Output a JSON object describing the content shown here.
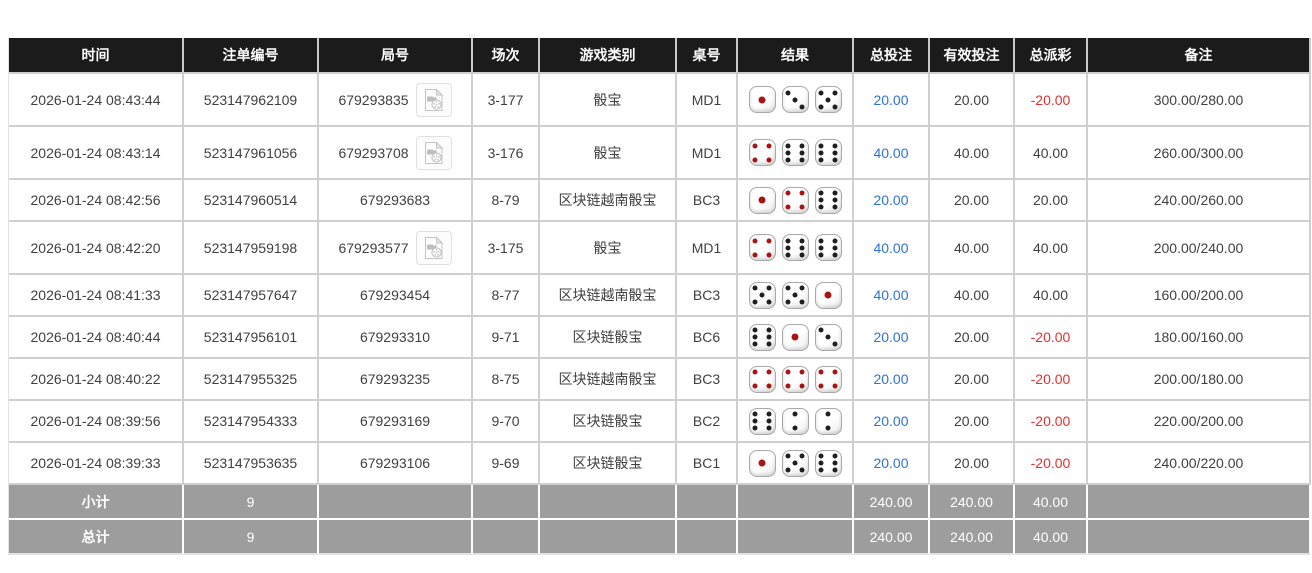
{
  "colors": {
    "header_bg": "#1b1b1b",
    "accent_blue": "#2e72d9",
    "negative_red": "#e03131",
    "summary_bg": "#9d9d9d",
    "grid_line": "#cfcfcf"
  },
  "icons": {
    "video_replay": "video-file-icon"
  },
  "table": {
    "columns": [
      {
        "key": "time",
        "label": "时间"
      },
      {
        "key": "bet_id",
        "label": "注单编号"
      },
      {
        "key": "round",
        "label": "局号"
      },
      {
        "key": "session",
        "label": "场次"
      },
      {
        "key": "game",
        "label": "游戏类别"
      },
      {
        "key": "table_no",
        "label": "桌号"
      },
      {
        "key": "result",
        "label": "结果"
      },
      {
        "key": "total_bet",
        "label": "总投注"
      },
      {
        "key": "valid_bet",
        "label": "有效投注"
      },
      {
        "key": "payout",
        "label": "总派彩"
      },
      {
        "key": "remark",
        "label": "备注"
      }
    ],
    "rows": [
      {
        "time": "2026-01-24 08:43:44",
        "bet_id": "523147962109",
        "round": "679293835",
        "has_video": true,
        "session": "3-177",
        "game": "骰宝",
        "table_no": "MD1",
        "dice": [
          1,
          3,
          5
        ],
        "total_bet": "20.00",
        "valid_bet": "20.00",
        "payout": "-20.00",
        "remark": "300.00/280.00"
      },
      {
        "time": "2026-01-24 08:43:14",
        "bet_id": "523147961056",
        "round": "679293708",
        "has_video": true,
        "session": "3-176",
        "game": "骰宝",
        "table_no": "MD1",
        "dice": [
          4,
          6,
          6
        ],
        "total_bet": "40.00",
        "valid_bet": "40.00",
        "payout": "40.00",
        "remark": "260.00/300.00"
      },
      {
        "time": "2026-01-24 08:42:56",
        "bet_id": "523147960514",
        "round": "679293683",
        "has_video": false,
        "session": "8-79",
        "game": "区块链越南骰宝",
        "table_no": "BC3",
        "dice": [
          1,
          4,
          6
        ],
        "total_bet": "20.00",
        "valid_bet": "20.00",
        "payout": "20.00",
        "remark": "240.00/260.00"
      },
      {
        "time": "2026-01-24 08:42:20",
        "bet_id": "523147959198",
        "round": "679293577",
        "has_video": true,
        "session": "3-175",
        "game": "骰宝",
        "table_no": "MD1",
        "dice": [
          4,
          6,
          6
        ],
        "total_bet": "40.00",
        "valid_bet": "40.00",
        "payout": "40.00",
        "remark": "200.00/240.00"
      },
      {
        "time": "2026-01-24 08:41:33",
        "bet_id": "523147957647",
        "round": "679293454",
        "has_video": false,
        "session": "8-77",
        "game": "区块链越南骰宝",
        "table_no": "BC3",
        "dice": [
          5,
          5,
          1
        ],
        "total_bet": "40.00",
        "valid_bet": "40.00",
        "payout": "40.00",
        "remark": "160.00/200.00"
      },
      {
        "time": "2026-01-24 08:40:44",
        "bet_id": "523147956101",
        "round": "679293310",
        "has_video": false,
        "session": "9-71",
        "game": "区块链骰宝",
        "table_no": "BC6",
        "dice": [
          6,
          1,
          3
        ],
        "total_bet": "20.00",
        "valid_bet": "20.00",
        "payout": "-20.00",
        "remark": "180.00/160.00"
      },
      {
        "time": "2026-01-24 08:40:22",
        "bet_id": "523147955325",
        "round": "679293235",
        "has_video": false,
        "session": "8-75",
        "game": "区块链越南骰宝",
        "table_no": "BC3",
        "dice": [
          4,
          4,
          4
        ],
        "total_bet": "20.00",
        "valid_bet": "20.00",
        "payout": "-20.00",
        "remark": "200.00/180.00"
      },
      {
        "time": "2026-01-24 08:39:56",
        "bet_id": "523147954333",
        "round": "679293169",
        "has_video": false,
        "session": "9-70",
        "game": "区块链骰宝",
        "table_no": "BC2",
        "dice": [
          6,
          2,
          2
        ],
        "total_bet": "20.00",
        "valid_bet": "20.00",
        "payout": "-20.00",
        "remark": "220.00/200.00"
      },
      {
        "time": "2026-01-24 08:39:33",
        "bet_id": "523147953635",
        "round": "679293106",
        "has_video": false,
        "session": "9-69",
        "game": "区块链骰宝",
        "table_no": "BC1",
        "dice": [
          1,
          5,
          6
        ],
        "total_bet": "20.00",
        "valid_bet": "20.00",
        "payout": "-20.00",
        "remark": "240.00/220.00"
      }
    ],
    "summary_rows": [
      {
        "label": "小计",
        "count": "9",
        "total_bet": "240.00",
        "valid_bet": "240.00",
        "payout": "40.00"
      },
      {
        "label": "总计",
        "count": "9",
        "total_bet": "240.00",
        "valid_bet": "240.00",
        "payout": "40.00"
      }
    ]
  }
}
